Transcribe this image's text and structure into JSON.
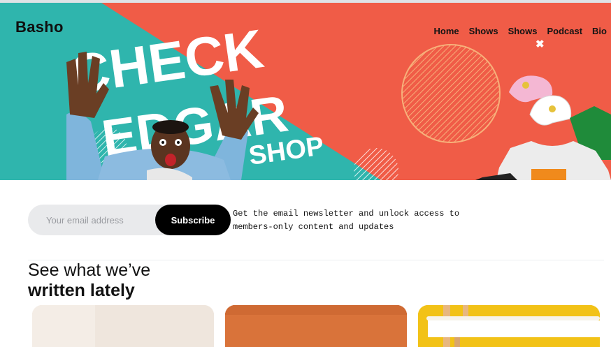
{
  "site": {
    "brand": "Basho"
  },
  "nav": {
    "items": [
      "Home",
      "Shows",
      "Shows",
      "Podcast",
      "Bio"
    ]
  },
  "hero": {
    "banner_line1": "CHECK",
    "banner_line2": "EDGAR",
    "banner_line3": "SHOP",
    "close_icon": "close-icon"
  },
  "newsletter": {
    "email_placeholder": "Your email address",
    "email_value": "",
    "subscribe_label": "Subscribe",
    "note_line1": "Get the email newsletter and unlock access to",
    "note_line2": "members-only content and updates"
  },
  "section": {
    "title_light": "See what we’ve",
    "title_bold": "written lately"
  },
  "colors": {
    "teal": "#2fb5ad",
    "coral": "#f05c47",
    "orange": "#f7a25a",
    "card_beige": "#efe6dd",
    "card_orange": "#d9733a",
    "card_yellow": "#f2c217"
  }
}
